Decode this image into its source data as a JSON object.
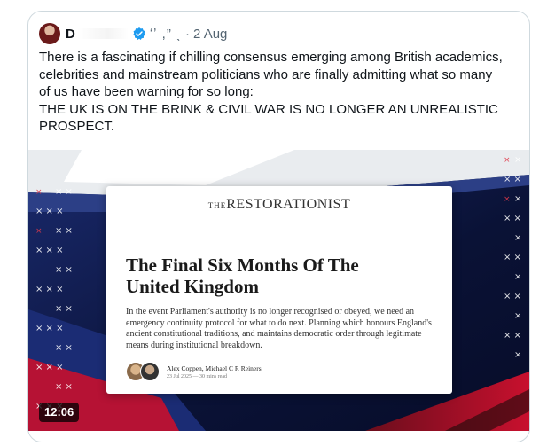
{
  "tweet": {
    "author_name": "D",
    "handle": "ʻʼ ,” ˎ",
    "date": "2 Aug",
    "text": "There is a fascinating if chilling consensus emerging among British academics,\ncelebrities and mainstream politicians who are finally admitting what so many\nof us have been warning for so long:\nTHE UK IS ON THE BRINK & CIVIL WAR IS NO LONGER AN UNREALISTIC\nPROSPECT."
  },
  "media": {
    "duration": "12:06",
    "article": {
      "brand_prefix": "THE",
      "brand": "RESTORATIONIST",
      "headline": "The Final Six Months Of The\nUnited Kingdom",
      "summary": "In the event Parliament's authority is no longer recognised or obeyed, we need an emergency continuity protocol for what to do next. Planning which honours England's ancient constitutional traditions, and maintains democratic order through legitimate means during institutional breakdown.",
      "authors": "Alex Coppen, Michael C R Reiners",
      "meta": "23 Jul 2025 — 30 mins read"
    }
  },
  "colors": {
    "text": "#0f1419",
    "muted": "#536471",
    "border": "#cfd9de",
    "verified": "#1d9bf0",
    "flag_blue": "#0a1236",
    "flag_red": "#c8102e"
  }
}
